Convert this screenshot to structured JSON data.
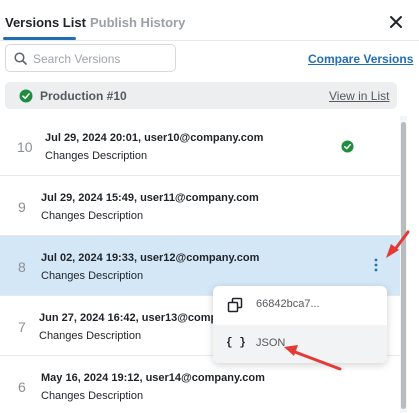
{
  "tabs": [
    {
      "label": "Versions List",
      "active": true
    },
    {
      "label": "Publish History",
      "active": false
    }
  ],
  "close_icon": "close-icon",
  "search": {
    "placeholder": "Search Versions",
    "value": ""
  },
  "compare_link": "Compare Versions",
  "production": {
    "label": "Production #10",
    "link": "View in List",
    "status_icon": "check-circle-icon"
  },
  "versions": [
    {
      "number": "10",
      "title": "Jul 29, 2024 20:01, user10@company.com",
      "description": "Changes Description",
      "published": true
    },
    {
      "number": "9",
      "title": "Jul 29, 2024 15:49, user11@company.com",
      "description": "Changes Description"
    },
    {
      "number": "8",
      "title": "Jul 02, 2024 19:33, user12@company.com",
      "description": "Changes Description",
      "selected": true
    },
    {
      "number": "7",
      "title": "Jun 27, 2024 16:42, user13@company.com",
      "description": "Changes Description"
    },
    {
      "number": "6",
      "title": "May 16, 2024 19:12, user14@company.com",
      "description": "Changes Description"
    }
  ],
  "context_menu": {
    "items": [
      {
        "label": "66842bca7...",
        "icon": "copy-icon"
      },
      {
        "label": "JSON",
        "icon": "braces-icon",
        "icon_text": "{ }"
      }
    ]
  },
  "colors": {
    "accent": "#1f6fb2",
    "success": "#1e8e3e",
    "selected_row": "#d3e7f6",
    "annotation": "#e53935"
  }
}
